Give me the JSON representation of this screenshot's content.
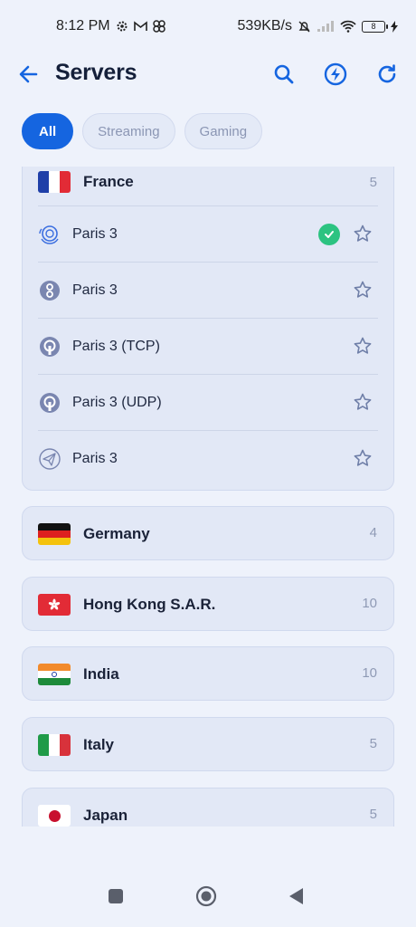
{
  "status_bar": {
    "time": "8:12 PM",
    "left_icons": [
      "gear-icon",
      "gmail-icon",
      "fan-icon"
    ],
    "net_speed": "539KB/s",
    "battery_level": "8",
    "right_icons": [
      "bell-muted-icon",
      "signal-icon",
      "wifi-icon",
      "battery-icon",
      "charging-icon"
    ]
  },
  "header": {
    "title": "Servers",
    "icons": [
      "back-arrow-icon",
      "search-icon",
      "bolt-icon",
      "refresh-icon"
    ]
  },
  "filters": [
    {
      "label": "All",
      "active": true
    },
    {
      "label": "Streaming",
      "active": false
    },
    {
      "label": "Gaming",
      "active": false
    }
  ],
  "expanded_country": {
    "name": "France",
    "count": "5",
    "servers": [
      {
        "name": "Paris 3",
        "protocol_icon": "hysteria-icon",
        "connected": true
      },
      {
        "name": "Paris 3",
        "protocol_icon": "shadowsocks-icon",
        "connected": false
      },
      {
        "name": "Paris 3 (TCP)",
        "protocol_icon": "openvpn-icon",
        "connected": false
      },
      {
        "name": "Paris 3 (UDP)",
        "protocol_icon": "openvpn-icon",
        "connected": false
      },
      {
        "name": "Paris 3",
        "protocol_icon": "paper-plane-icon",
        "connected": false
      }
    ]
  },
  "countries": [
    {
      "name": "Germany",
      "count": "4",
      "flag": "germany-flag"
    },
    {
      "name": "Hong Kong S.A.R.",
      "count": "10",
      "flag": "hong-kong-flag"
    },
    {
      "name": "India",
      "count": "10",
      "flag": "india-flag"
    },
    {
      "name": "Italy",
      "count": "5",
      "flag": "italy-flag"
    },
    {
      "name": "Japan",
      "count": "5",
      "flag": "japan-flag"
    }
  ],
  "colors": {
    "accent": "#1565e0",
    "background": "#eef2fb",
    "card": "#e2e8f6",
    "connected": "#2cc381",
    "muted_text": "#8f9ab5"
  },
  "nav_bar": [
    "recents-square-icon",
    "home-circle-icon",
    "back-triangle-icon"
  ]
}
